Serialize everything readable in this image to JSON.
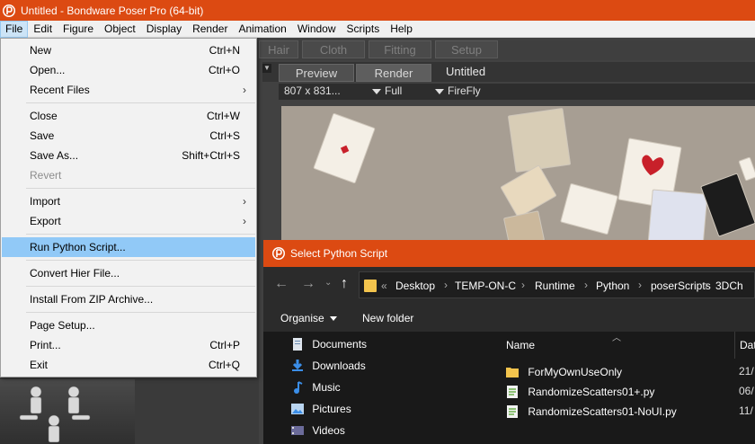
{
  "window": {
    "title": "Untitled - Bondware Poser Pro  (64-bit)"
  },
  "menubar": {
    "items": [
      "File",
      "Edit",
      "Figure",
      "Object",
      "Display",
      "Render",
      "Animation",
      "Window",
      "Scripts",
      "Help"
    ],
    "active": "File"
  },
  "room_tabs": [
    "Hair",
    "Cloth",
    "Fitting",
    "Setup"
  ],
  "doc_tabs": {
    "preview": "Preview",
    "render": "Render",
    "title": "Untitled"
  },
  "render_toolbar": {
    "size": "807 x 831...",
    "mode": "Full",
    "engine": "FireFly"
  },
  "file_menu": {
    "items": {
      "new": {
        "label": "New",
        "shortcut": "Ctrl+N"
      },
      "open": {
        "label": "Open...",
        "shortcut": "Ctrl+O"
      },
      "recent": {
        "label": "Recent Files"
      },
      "close": {
        "label": "Close",
        "shortcut": "Ctrl+W"
      },
      "save": {
        "label": "Save",
        "shortcut": "Ctrl+S"
      },
      "save_as": {
        "label": "Save As...",
        "shortcut": "Shift+Ctrl+S"
      },
      "revert": {
        "label": "Revert"
      },
      "import": {
        "label": "Import"
      },
      "export": {
        "label": "Export"
      },
      "run_python": {
        "label": "Run Python Script..."
      },
      "convert_hier": {
        "label": "Convert Hier File..."
      },
      "install_zip": {
        "label": "Install From ZIP Archive..."
      },
      "page_setup": {
        "label": "Page Setup..."
      },
      "print": {
        "label": "Print...",
        "shortcut": "Ctrl+P"
      },
      "exit": {
        "label": "Exit",
        "shortcut": "Ctrl+Q"
      }
    },
    "submenu_arrow": "›"
  },
  "dialog": {
    "title": "Select Python Script",
    "breadcrumb": [
      "Desktop",
      "TEMP-ON-C",
      "Runtime",
      "Python",
      "poserScripts",
      "3DCh"
    ],
    "breadcrumb_prefix": "«",
    "organise": "Organise",
    "new_folder": "New folder",
    "nav_items": [
      "Documents",
      "Downloads",
      "Music",
      "Pictures",
      "Videos"
    ],
    "columns": {
      "name": "Name",
      "date": "Dat"
    },
    "files": [
      {
        "name": "ForMyOwnUseOnly",
        "date": "21/",
        "type": "folder"
      },
      {
        "name": "RandomizeScatters01+.py",
        "date": "06/",
        "type": "python"
      },
      {
        "name": "RandomizeScatters01-NoUI.py",
        "date": "11/",
        "type": "python"
      }
    ]
  },
  "colors": {
    "accent": "#dc4a12",
    "menu_highlight": "#91c9f7",
    "menubar_active": "#cce4f7",
    "dialog_bg": "#191919"
  }
}
